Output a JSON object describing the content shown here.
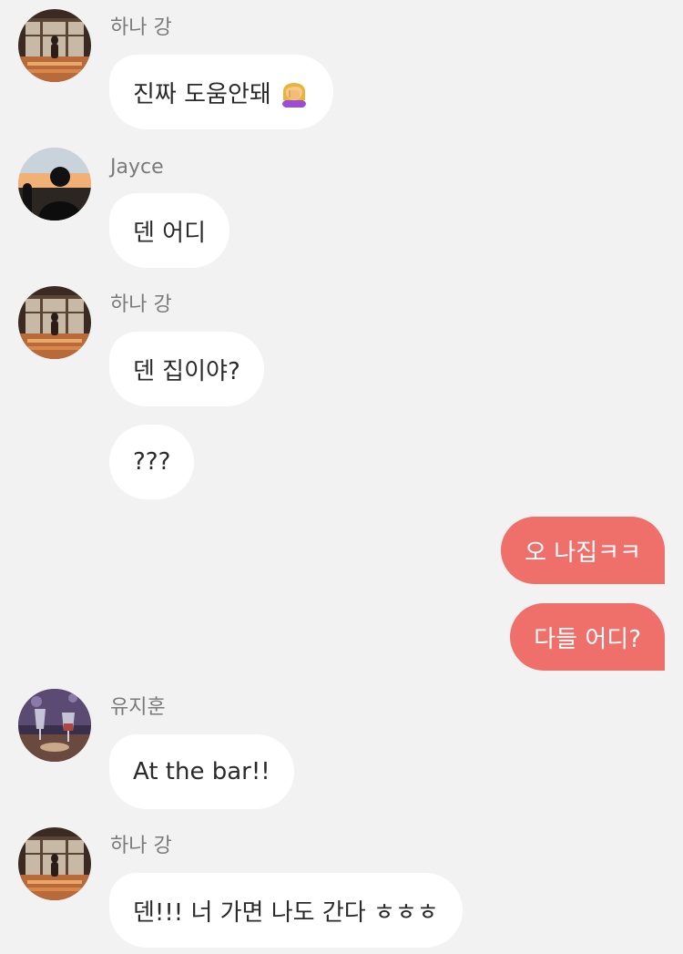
{
  "messages": [
    {
      "sender": "하나 강",
      "text": "진짜 도움안돼",
      "emoji": "woman-facepalming-icon"
    },
    {
      "sender": "Jayce",
      "text": "덴 어디"
    },
    {
      "sender": "하나 강",
      "text": "덴 집이야?"
    },
    {
      "text": "???"
    },
    {
      "text": "오 나집ㅋㅋ",
      "outgoing": true
    },
    {
      "text": "다들 어디?",
      "outgoing": true
    },
    {
      "sender": "유지훈",
      "text": "At the bar!!"
    },
    {
      "sender": "하나 강",
      "text": "덴!!! 너 가면 나도 간다 ㅎㅎㅎ"
    }
  ],
  "colors": {
    "background": "#f2f2f2",
    "incoming_bubble": "#ffffff",
    "outgoing_bubble": "#ef6f6b",
    "sender_name": "#7a7a7a"
  },
  "avatars": {
    "hana": "window-silhouette-avatar",
    "jayce": "sunset-silhouette-avatar",
    "jihoon": "wine-glasses-avatar"
  }
}
